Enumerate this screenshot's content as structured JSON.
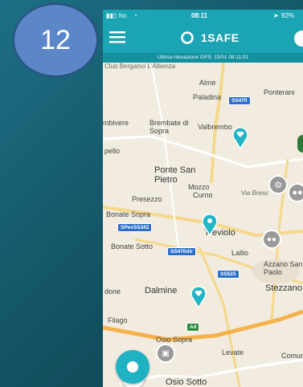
{
  "step_badge": "12",
  "status": {
    "carrier": "ho.",
    "time": "08:11",
    "battery": "92%"
  },
  "app": {
    "brand": "1SAFE",
    "menu_icon": "hamburger-menu-icon",
    "accent": "#1aa4b4"
  },
  "gps_note": "Ultima rilevazione GPS: 15/01 08:11:01",
  "map": {
    "places": [
      "Almè",
      "Paladina",
      "Ponterani",
      "Brembate di Sopra",
      "Valbrembo",
      "Ponte San Pietro",
      "Mozzo",
      "Curno",
      "Presezzo",
      "Bonate Sopra",
      "Bonate Sotto",
      "Treviolo",
      "Lallio",
      "Azzano San Paolo",
      "Stezzano",
      "Dalmine",
      "Filago",
      "Osio Sopra",
      "Levate",
      "Osio Sotto",
      "Comun",
      "Club Bergamo L'Albenza",
      "mbivere",
      "pello",
      "done",
      "Via Bresc"
    ],
    "roads": [
      "SS470",
      "SPexSS342",
      "SS470dir",
      "SS525",
      "A4"
    ]
  }
}
